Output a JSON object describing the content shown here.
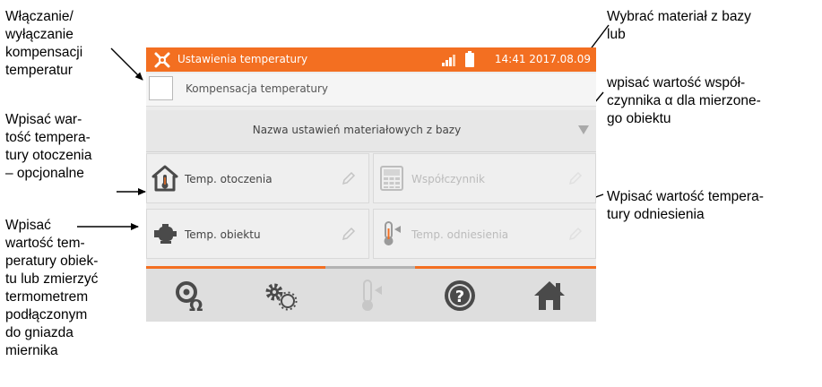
{
  "annotations": {
    "left_1": "Włączanie/\nwyłączanie\nkompensacji\ntemperatur",
    "left_2": "Wpisać war-\ntość tempera-\ntury otoczenia\n– opcjonalne",
    "left_3": "Wpisać\nwartość tem-\nperatury obiek-\ntu lub zmierzyć\ntermometrem\npodłączonym\ndo gniazda\nmiernika",
    "right_1": "Wybrać materiał z bazy\nlub",
    "right_2": "wpisać wartość współ-\nczynnika α dla mierzone-\ngo obiektu",
    "right_3": "Wpisać wartość tempera-\ntury odniesienia"
  },
  "status_bar": {
    "title": "Ustawienia temperatury",
    "time": "14:41 2017.08.09",
    "icons": [
      "settings-icon",
      "signal-icon",
      "battery-icon"
    ]
  },
  "compensation": {
    "label": "Kompensacja temperatury",
    "checked": false
  },
  "database": {
    "label": "Nazwa ustawień materiałowych z bazy"
  },
  "tiles": {
    "ambient": {
      "label": "Temp. otoczenia",
      "icon": "house-thermometer-icon"
    },
    "coefficient": {
      "label": "Współczynnik",
      "icon": "calculator-icon"
    },
    "object": {
      "label": "Temp. obiektu",
      "icon": "motor-icon"
    },
    "reference": {
      "label": "Temp. odniesienia",
      "icon": "thermometer-icon"
    }
  },
  "tabbar": {
    "items": [
      "resistance-icon",
      "gears-icon",
      "thermometer-icon",
      "help-icon",
      "home-icon"
    ]
  },
  "colors": {
    "accent": "#f36f21",
    "panel": "#ececec",
    "inactive": "#bbbbbb"
  }
}
